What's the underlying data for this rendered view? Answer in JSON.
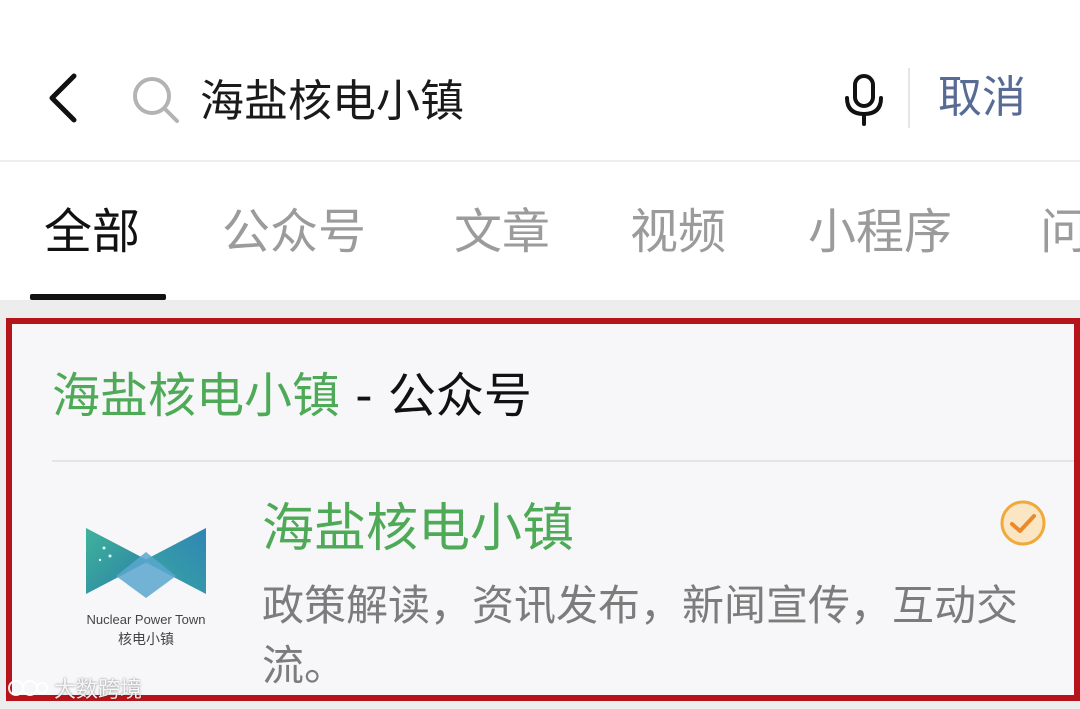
{
  "search": {
    "query": "海盐核电小镇",
    "cancel_label": "取消"
  },
  "tabs": [
    {
      "label": "全部",
      "active": true
    },
    {
      "label": "公众号"
    },
    {
      "label": "文章"
    },
    {
      "label": "视频"
    },
    {
      "label": "小程序"
    },
    {
      "label": "问"
    }
  ],
  "result": {
    "section_title_highlight": "海盐核电小镇",
    "section_title_suffix": " - 公众号",
    "account": {
      "name": "海盐核电小镇",
      "description": "政策解读，资讯发布，新闻宣传，互动交流。",
      "logo_text_en": "Nuclear Power Town",
      "logo_text_cn": "核电小镇",
      "verified": true
    }
  },
  "watermark": {
    "text": "大数跨境"
  },
  "colors": {
    "accent_green": "#4eaa57",
    "link_blue": "#576b95",
    "highlight_border": "#b5141b",
    "verified_orange": "#f0a93b"
  }
}
